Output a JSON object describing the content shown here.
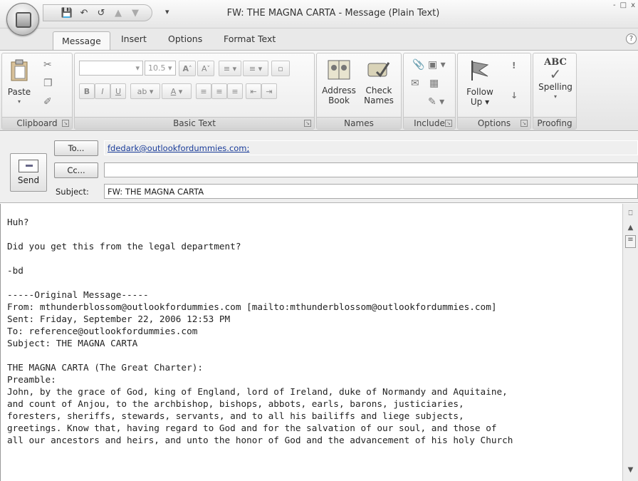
{
  "window": {
    "title": "FW: THE MAGNA CARTA - Message (Plain Text)",
    "controls": [
      "-",
      "□",
      "x"
    ]
  },
  "tabs": [
    "Message",
    "Insert",
    "Options",
    "Format Text"
  ],
  "ribbon": {
    "clipboard": {
      "label": "Clipboard",
      "paste": "Paste"
    },
    "basic_text": {
      "label": "Basic Text",
      "font_size": "10.5",
      "bold": "B",
      "italic": "I",
      "underline": "U",
      "grow": "A",
      "shrink": "A"
    },
    "names": {
      "label": "Names",
      "address_book_1": "Address",
      "address_book_2": "Book",
      "check_names_1": "Check",
      "check_names_2": "Names"
    },
    "include": {
      "label": "Include"
    },
    "options": {
      "label": "Options",
      "follow_up_1": "Follow",
      "follow_up_2": "Up",
      "high_importance": "!",
      "low_importance": "↓"
    },
    "proofing": {
      "label": "Proofing",
      "spelling": "Spelling",
      "abc": "ABC"
    }
  },
  "header": {
    "send": "Send",
    "to_button": "To...",
    "cc_button": "Cc...",
    "subject_label": "Subject:",
    "to_value": "fdedark@outlookfordummies.com;",
    "cc_value": "",
    "subject_value": "FW: THE MAGNA CARTA"
  },
  "body_text": "Huh?\n\nDid you get this from the legal department?\n\n-bd\n\n-----Original Message-----\nFrom: mthunderblossom@outlookfordummies.com [mailto:mthunderblossom@outlookfordummies.com]\nSent: Friday, September 22, 2006 12:53 PM\nTo: reference@outlookfordummies.com\nSubject: THE MAGNA CARTA\n\nTHE MAGNA CARTA (The Great Charter):\nPreamble:\nJohn, by the grace of God, king of England, lord of Ireland, duke of Normandy and Aquitaine,\nand count of Anjou, to the archbishop, bishops, abbots, earls, barons, justiciaries,\nforesters, sheriffs, stewards, servants, and to all his bailiffs and liege subjects,\ngreetings. Know that, having regard to God and for the salvation of our soul, and those of\nall our ancestors and heirs, and unto the honor of God and the advancement of his holy Church"
}
